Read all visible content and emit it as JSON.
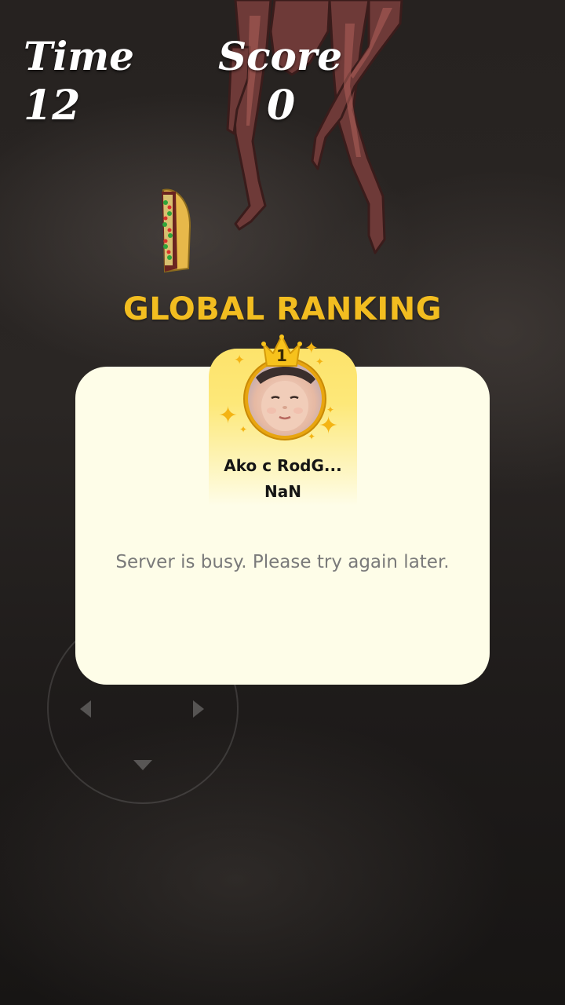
{
  "hud": {
    "time_label": "Time",
    "time_value": "12",
    "score_label": "Score",
    "score_value": "0"
  },
  "ranking": {
    "title": "GLOBAL RANKING",
    "top_player": {
      "rank": "1",
      "name": "Ako c RodG...",
      "score": "NaN"
    },
    "status_message": "Server is busy. Please try again later."
  },
  "colors": {
    "title_gold": "#f2bd20",
    "card_bg": "#fefde8",
    "badge_gold": "#fde36b",
    "message_gray": "#7a7a7a"
  },
  "icons": {
    "crown": "crown-icon",
    "sparkle": "sparkle-icon",
    "collectible": "taco-icon",
    "joystick_arrows": [
      "arrow-left-icon",
      "arrow-right-icon",
      "arrow-down-icon"
    ]
  }
}
